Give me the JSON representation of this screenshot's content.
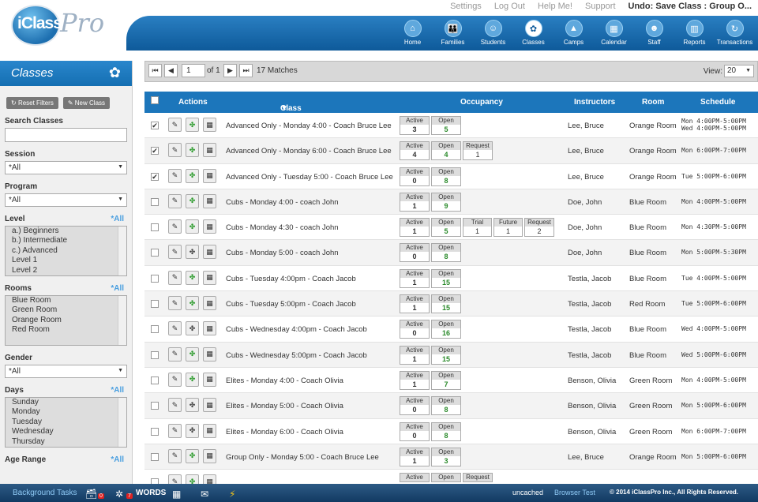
{
  "app": {
    "logo_text": "iClass",
    "logo_suffix": "Pro"
  },
  "toplinks": {
    "settings": "Settings",
    "logout": "Log Out",
    "help": "Help Me!",
    "support": "Support",
    "undo_label": "Undo:",
    "undo_value": "Save Class : Group O..."
  },
  "nav": [
    {
      "label": "Home",
      "icon": "home-icon"
    },
    {
      "label": "Families",
      "icon": "families-icon"
    },
    {
      "label": "Students",
      "icon": "students-icon"
    },
    {
      "label": "Classes",
      "icon": "classes-icon",
      "active": true
    },
    {
      "label": "Camps",
      "icon": "camps-icon"
    },
    {
      "label": "Calendar",
      "icon": "calendar-icon"
    },
    {
      "label": "Staff",
      "icon": "staff-icon"
    },
    {
      "label": "Reports",
      "icon": "reports-icon"
    },
    {
      "label": "Transactions",
      "icon": "transactions-icon"
    }
  ],
  "sidebar": {
    "title": "Classes",
    "reset": "Reset Filters",
    "new_class": "New Class",
    "search_label": "Search Classes",
    "search_value": "",
    "session_label": "Session",
    "session_value": "*All",
    "program_label": "Program",
    "program_value": "*All",
    "level_label": "Level",
    "all": "*All",
    "levels": [
      "a.) Beginners",
      "b.) Intermediate",
      "c.) Advanced",
      "Level 1",
      "Level 2"
    ],
    "rooms_label": "Rooms",
    "rooms": [
      "Blue Room",
      "Green Room",
      "Orange Room",
      "Red Room"
    ],
    "gender_label": "Gender",
    "gender_value": "*All",
    "days_label": "Days",
    "days": [
      "Sunday",
      "Monday",
      "Tuesday",
      "Wednesday",
      "Thursday"
    ],
    "age_label": "Age Range"
  },
  "pager": {
    "page": "1",
    "of": "of 1",
    "matches": "17 Matches",
    "view_label": "View:",
    "view_value": "20"
  },
  "columns": {
    "actions": "Actions",
    "class_name": "Class Name",
    "occupancy": "Occupancy",
    "instructors": "Instructors",
    "room": "Room",
    "schedule": "Schedule"
  },
  "rows": [
    {
      "checked": true,
      "name": "Advanced Only - Monday 4:00 - Coach Bruce Lee",
      "occ": [
        [
          "Active",
          "3"
        ],
        [
          "Open",
          "5"
        ]
      ],
      "instr": "Lee, Bruce",
      "room": "Orange Room",
      "sched": [
        "Mon 4:00PM-5:00PM",
        "Wed 4:00PM-5:00PM"
      ],
      "green": true
    },
    {
      "checked": true,
      "name": "Advanced Only - Monday 6:00 - Coach Bruce Lee",
      "occ": [
        [
          "Active",
          "4"
        ],
        [
          "Open",
          "4"
        ],
        [
          "Request",
          "1"
        ]
      ],
      "instr": "Lee, Bruce",
      "room": "Orange Room",
      "sched": [
        "Mon 6:00PM-7:00PM"
      ],
      "green": true
    },
    {
      "checked": true,
      "name": "Advanced Only - Tuesday 5:00 - Coach Bruce Lee",
      "occ": [
        [
          "Active",
          "0"
        ],
        [
          "Open",
          "8"
        ]
      ],
      "instr": "Lee, Bruce",
      "room": "Orange Room",
      "sched": [
        "Tue 5:00PM-6:00PM"
      ],
      "green": true
    },
    {
      "checked": false,
      "name": "Cubs - Monday 4:00 - coach John",
      "occ": [
        [
          "Active",
          "1"
        ],
        [
          "Open",
          "9"
        ]
      ],
      "instr": "Doe, John",
      "room": "Blue Room",
      "sched": [
        "Mon 4:00PM-5:00PM"
      ],
      "green": true
    },
    {
      "checked": false,
      "name": "Cubs - Monday 4:30 - coach John",
      "occ": [
        [
          "Active",
          "1"
        ],
        [
          "Open",
          "5"
        ],
        [
          "Trial",
          "1"
        ],
        [
          "Future",
          "1"
        ],
        [
          "Request",
          "2"
        ]
      ],
      "instr": "Doe, John",
      "room": "Blue Room",
      "sched": [
        "Mon 4:30PM-5:00PM"
      ],
      "green": true
    },
    {
      "checked": false,
      "name": "Cubs - Monday 5:00 - coach John",
      "occ": [
        [
          "Active",
          "0"
        ],
        [
          "Open",
          "8"
        ]
      ],
      "instr": "Doe, John",
      "room": "Blue Room",
      "sched": [
        "Mon 5:00PM-5:30PM"
      ],
      "green": false
    },
    {
      "checked": false,
      "name": "Cubs - Tuesday 4:00pm - Coach Jacob",
      "occ": [
        [
          "Active",
          "1"
        ],
        [
          "Open",
          "15"
        ]
      ],
      "instr": "Testla, Jacob",
      "room": "Blue Room",
      "sched": [
        "Tue 4:00PM-5:00PM"
      ],
      "green": true
    },
    {
      "checked": false,
      "name": "Cubs - Tuesday 5:00pm - Coach Jacob",
      "occ": [
        [
          "Active",
          "1"
        ],
        [
          "Open",
          "15"
        ]
      ],
      "instr": "Testla, Jacob",
      "room": "Red Room",
      "sched": [
        "Tue 5:00PM-6:00PM"
      ],
      "green": true
    },
    {
      "checked": false,
      "name": "Cubs - Wednesday 4:00pm - Coach Jacob",
      "occ": [
        [
          "Active",
          "0"
        ],
        [
          "Open",
          "16"
        ]
      ],
      "instr": "Testla, Jacob",
      "room": "Blue Room",
      "sched": [
        "Wed 4:00PM-5:00PM"
      ],
      "green": false
    },
    {
      "checked": false,
      "name": "Cubs - Wednesday 5:00pm - Coach Jacob",
      "occ": [
        [
          "Active",
          "1"
        ],
        [
          "Open",
          "15"
        ]
      ],
      "instr": "Testla, Jacob",
      "room": "Blue Room",
      "sched": [
        "Wed 5:00PM-6:00PM"
      ],
      "green": true
    },
    {
      "checked": false,
      "name": "Elites - Monday 4:00 - Coach Olivia",
      "occ": [
        [
          "Active",
          "1"
        ],
        [
          "Open",
          "7"
        ]
      ],
      "instr": "Benson, Olivia",
      "room": "Green Room",
      "sched": [
        "Mon 4:00PM-5:00PM"
      ],
      "green": true
    },
    {
      "checked": false,
      "name": "Elites - Monday 5:00 - Coach Olivia",
      "occ": [
        [
          "Active",
          "0"
        ],
        [
          "Open",
          "8"
        ]
      ],
      "instr": "Benson, Olivia",
      "room": "Green Room",
      "sched": [
        "Mon 5:00PM-6:00PM"
      ],
      "green": false
    },
    {
      "checked": false,
      "name": "Elites - Monday 6:00 - Coach Olivia",
      "occ": [
        [
          "Active",
          "0"
        ],
        [
          "Open",
          "8"
        ]
      ],
      "instr": "Benson, Olivia",
      "room": "Green Room",
      "sched": [
        "Mon 6:00PM-7:00PM"
      ],
      "green": false
    },
    {
      "checked": false,
      "name": "Group Only - Monday 5:00 - Coach Bruce Lee",
      "occ": [
        [
          "Active",
          "1"
        ],
        [
          "Open",
          "3"
        ]
      ],
      "instr": "Lee, Bruce",
      "room": "Orange Room",
      "sched": [
        "Mon 5:00PM-6:00PM"
      ],
      "green": true
    },
    {
      "checked": false,
      "name": "",
      "occ": [
        [
          "Active",
          ""
        ],
        [
          "Open",
          ""
        ],
        [
          "Request",
          ""
        ]
      ],
      "instr": "",
      "room": "",
      "sched": [
        ""
      ],
      "green": true
    }
  ],
  "footer": {
    "tasks": "Background Tasks",
    "badge1": "0",
    "badge2": "7",
    "words": "WORDS",
    "uncached": "uncached",
    "browser_test": "Browser Test",
    "copyright": "© 2014 iClassPro Inc., All Rights Reserved."
  }
}
